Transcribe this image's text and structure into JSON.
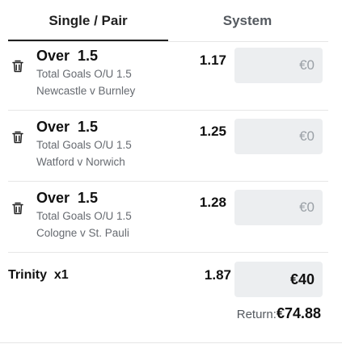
{
  "tabs": {
    "single_pair": "Single / Pair",
    "system": "System"
  },
  "bets": [
    {
      "market": "Over  1.5",
      "subtitle": "Total Goals O/U 1.5",
      "event": "Newcastle v Burnley",
      "odds": "1.17",
      "stake": "€0",
      "delete_icon": "trash-icon"
    },
    {
      "market": "Over  1.5",
      "subtitle": "Total Goals O/U 1.5",
      "event": "Watford v Norwich",
      "odds": "1.25",
      "stake": "€0",
      "delete_icon": "trash-icon"
    },
    {
      "market": "Over  1.5",
      "subtitle": "Total Goals O/U 1.5",
      "event": "Cologne v St. Pauli",
      "odds": "1.28",
      "stake": "€0",
      "delete_icon": "trash-icon"
    }
  ],
  "combo": {
    "label": "Trinity  x1",
    "odds": "1.87",
    "stake": "€40"
  },
  "return": {
    "label": "Return:",
    "value": "€74.88"
  },
  "colors": {
    "text": "#111111",
    "muted": "#666a70",
    "input_bg": "#eceef0",
    "divider": "#e6e6e6"
  }
}
